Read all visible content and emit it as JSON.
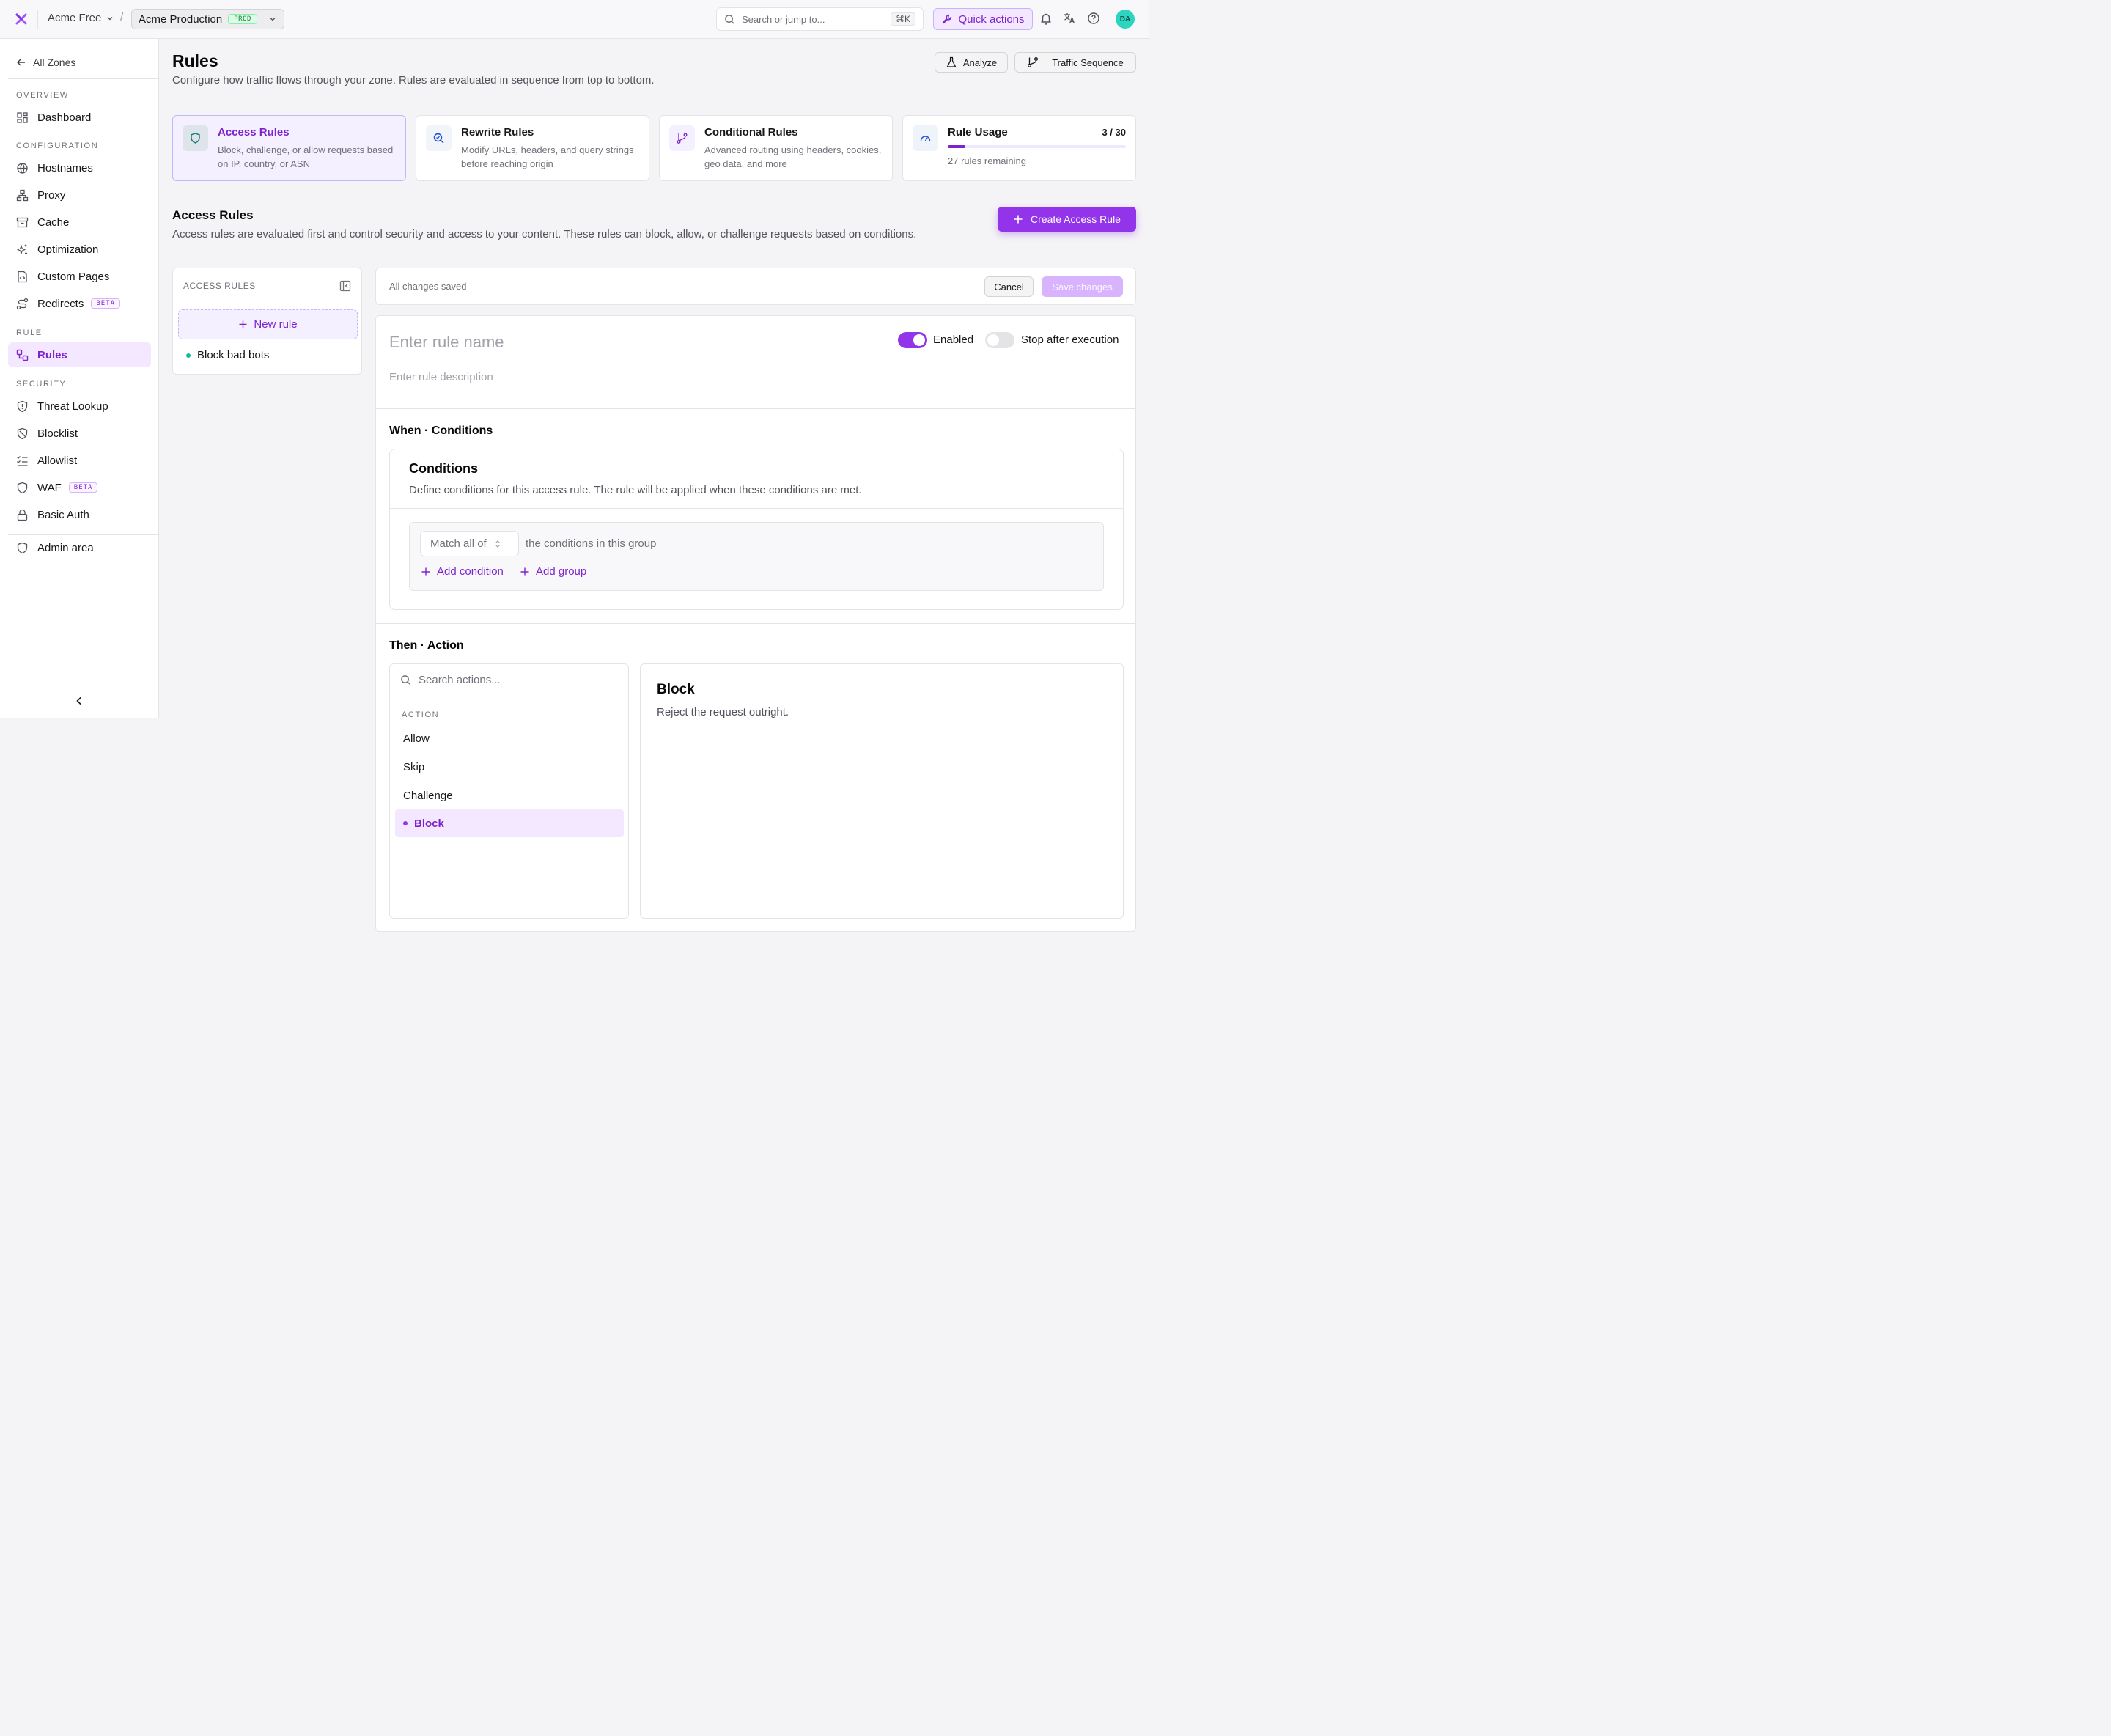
{
  "topbar": {
    "org_name": "Acme Free",
    "separator": "/",
    "zone_name": "Acme Production",
    "zone_badge": "PROD",
    "search_placeholder": "Search or jump to...",
    "search_shortcut": "⌘K",
    "quick_actions_label": "Quick actions",
    "avatar_initials": "DA"
  },
  "sidebar": {
    "back_label": "All Zones",
    "sections": {
      "overview": "OVERVIEW",
      "configuration": "CONFIGURATION",
      "rule": "RULE",
      "security": "SECURITY"
    },
    "items": {
      "dashboard": "Dashboard",
      "hostnames": "Hostnames",
      "proxy": "Proxy",
      "cache": "Cache",
      "optimization": "Optimization",
      "custom_pages": "Custom Pages",
      "redirects": "Redirects",
      "rules": "Rules",
      "threat_lookup": "Threat Lookup",
      "blocklist": "Blocklist",
      "allowlist": "Allowlist",
      "waf": "WAF",
      "basic_auth": "Basic Auth",
      "admin_area": "Admin area"
    },
    "beta_label": "BETA",
    "active_item": "rules"
  },
  "page": {
    "title": "Rules",
    "subtitle": "Configure how traffic flows through your zone. Rules are evaluated in sequence from top to bottom.",
    "analyze_label": "Analyze",
    "traffic_sequence_label": "Traffic Sequence"
  },
  "rule_types": [
    {
      "title": "Access Rules",
      "description": "Block, challenge, or allow requests based on IP, country, or ASN",
      "icon": "shield-icon",
      "selected": true
    },
    {
      "title": "Rewrite Rules",
      "description": "Modify URLs, headers, and query strings before reaching origin",
      "icon": "search-check-icon",
      "selected": false
    },
    {
      "title": "Conditional Rules",
      "description": "Advanced routing using headers, cookies, geo data, and more",
      "icon": "git-branch-icon",
      "selected": false
    }
  ],
  "usage": {
    "title": "Rule Usage",
    "value_text": "3 / 30",
    "used": 3,
    "limit": 30,
    "remaining_text": "27 rules remaining"
  },
  "access_section": {
    "title": "Access Rules",
    "subtitle": "Access rules are evaluated first and control security and access to your content. These rules can block, allow, or challenge requests based on conditions.",
    "create_label": "Create Access Rule"
  },
  "rule_list": {
    "header": "ACCESS RULES",
    "new_rule_label": "New rule",
    "rules": [
      "Block bad bots"
    ]
  },
  "save_bar": {
    "status": "All changes saved",
    "cancel_label": "Cancel",
    "save_label": "Save changes"
  },
  "editor": {
    "name_placeholder": "Enter rule name",
    "description_placeholder": "Enter rule description",
    "enabled_label": "Enabled",
    "enabled": true,
    "stop_label": "Stop after execution",
    "stop_after_execution": false,
    "when_title": "When · Conditions",
    "conditions_title": "Conditions",
    "conditions_subtitle": "Define conditions for this access rule. The rule will be applied when these conditions are met.",
    "match_value": "Match all of",
    "match_tail": "the conditions in this group",
    "add_condition_label": "Add condition",
    "add_group_label": "Add group",
    "then_title": "Then · Action",
    "action_search_placeholder": "Search actions...",
    "action_header": "ACTION",
    "actions": [
      "Allow",
      "Skip",
      "Challenge",
      "Block"
    ],
    "selected_action": "Block",
    "detail_title": "Block",
    "detail_description": "Reject the request outright."
  },
  "colors": {
    "accent": "#9333ea",
    "accent_text": "#7e22ce",
    "accent_bg": "#f3e8ff",
    "rule_dot": "#14b8a6",
    "prod_badge": "#15803d"
  }
}
